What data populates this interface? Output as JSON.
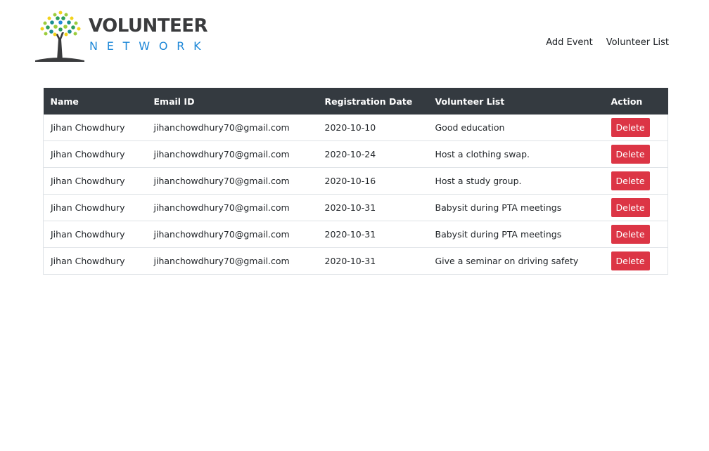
{
  "brand": {
    "title": "VOLUNTEER",
    "subtitle": "NETWORK",
    "colors": {
      "title": "#3a3b3d",
      "subtitle": "#1e88d8"
    }
  },
  "nav": {
    "items": [
      {
        "label": "Add Event"
      },
      {
        "label": "Volunteer List"
      }
    ]
  },
  "table": {
    "headers": [
      "Name",
      "Email ID",
      "Registration Date",
      "Volunteer List",
      "Action"
    ],
    "rows": [
      {
        "name": "Jihan Chowdhury",
        "email": "jihanchowdhury70@gmail.com",
        "date": "2020-10-10",
        "event": "Good education",
        "action": "Delete"
      },
      {
        "name": "Jihan Chowdhury",
        "email": "jihanchowdhury70@gmail.com",
        "date": "2020-10-24",
        "event": "Host a clothing swap.",
        "action": "Delete"
      },
      {
        "name": "Jihan Chowdhury",
        "email": "jihanchowdhury70@gmail.com",
        "date": "2020-10-16",
        "event": "Host a study group.",
        "action": "Delete"
      },
      {
        "name": "Jihan Chowdhury",
        "email": "jihanchowdhury70@gmail.com",
        "date": "2020-10-31",
        "event": "Babysit during PTA meetings",
        "action": "Delete"
      },
      {
        "name": "Jihan Chowdhury",
        "email": "jihanchowdhury70@gmail.com",
        "date": "2020-10-31",
        "event": "Babysit during PTA meetings",
        "action": "Delete"
      },
      {
        "name": "Jihan Chowdhury",
        "email": "jihanchowdhury70@gmail.com",
        "date": "2020-10-31",
        "event": "Give a seminar on driving safety",
        "action": "Delete"
      }
    ],
    "colors": {
      "header_bg": "#343a40",
      "delete_button": "#dc3545"
    }
  }
}
